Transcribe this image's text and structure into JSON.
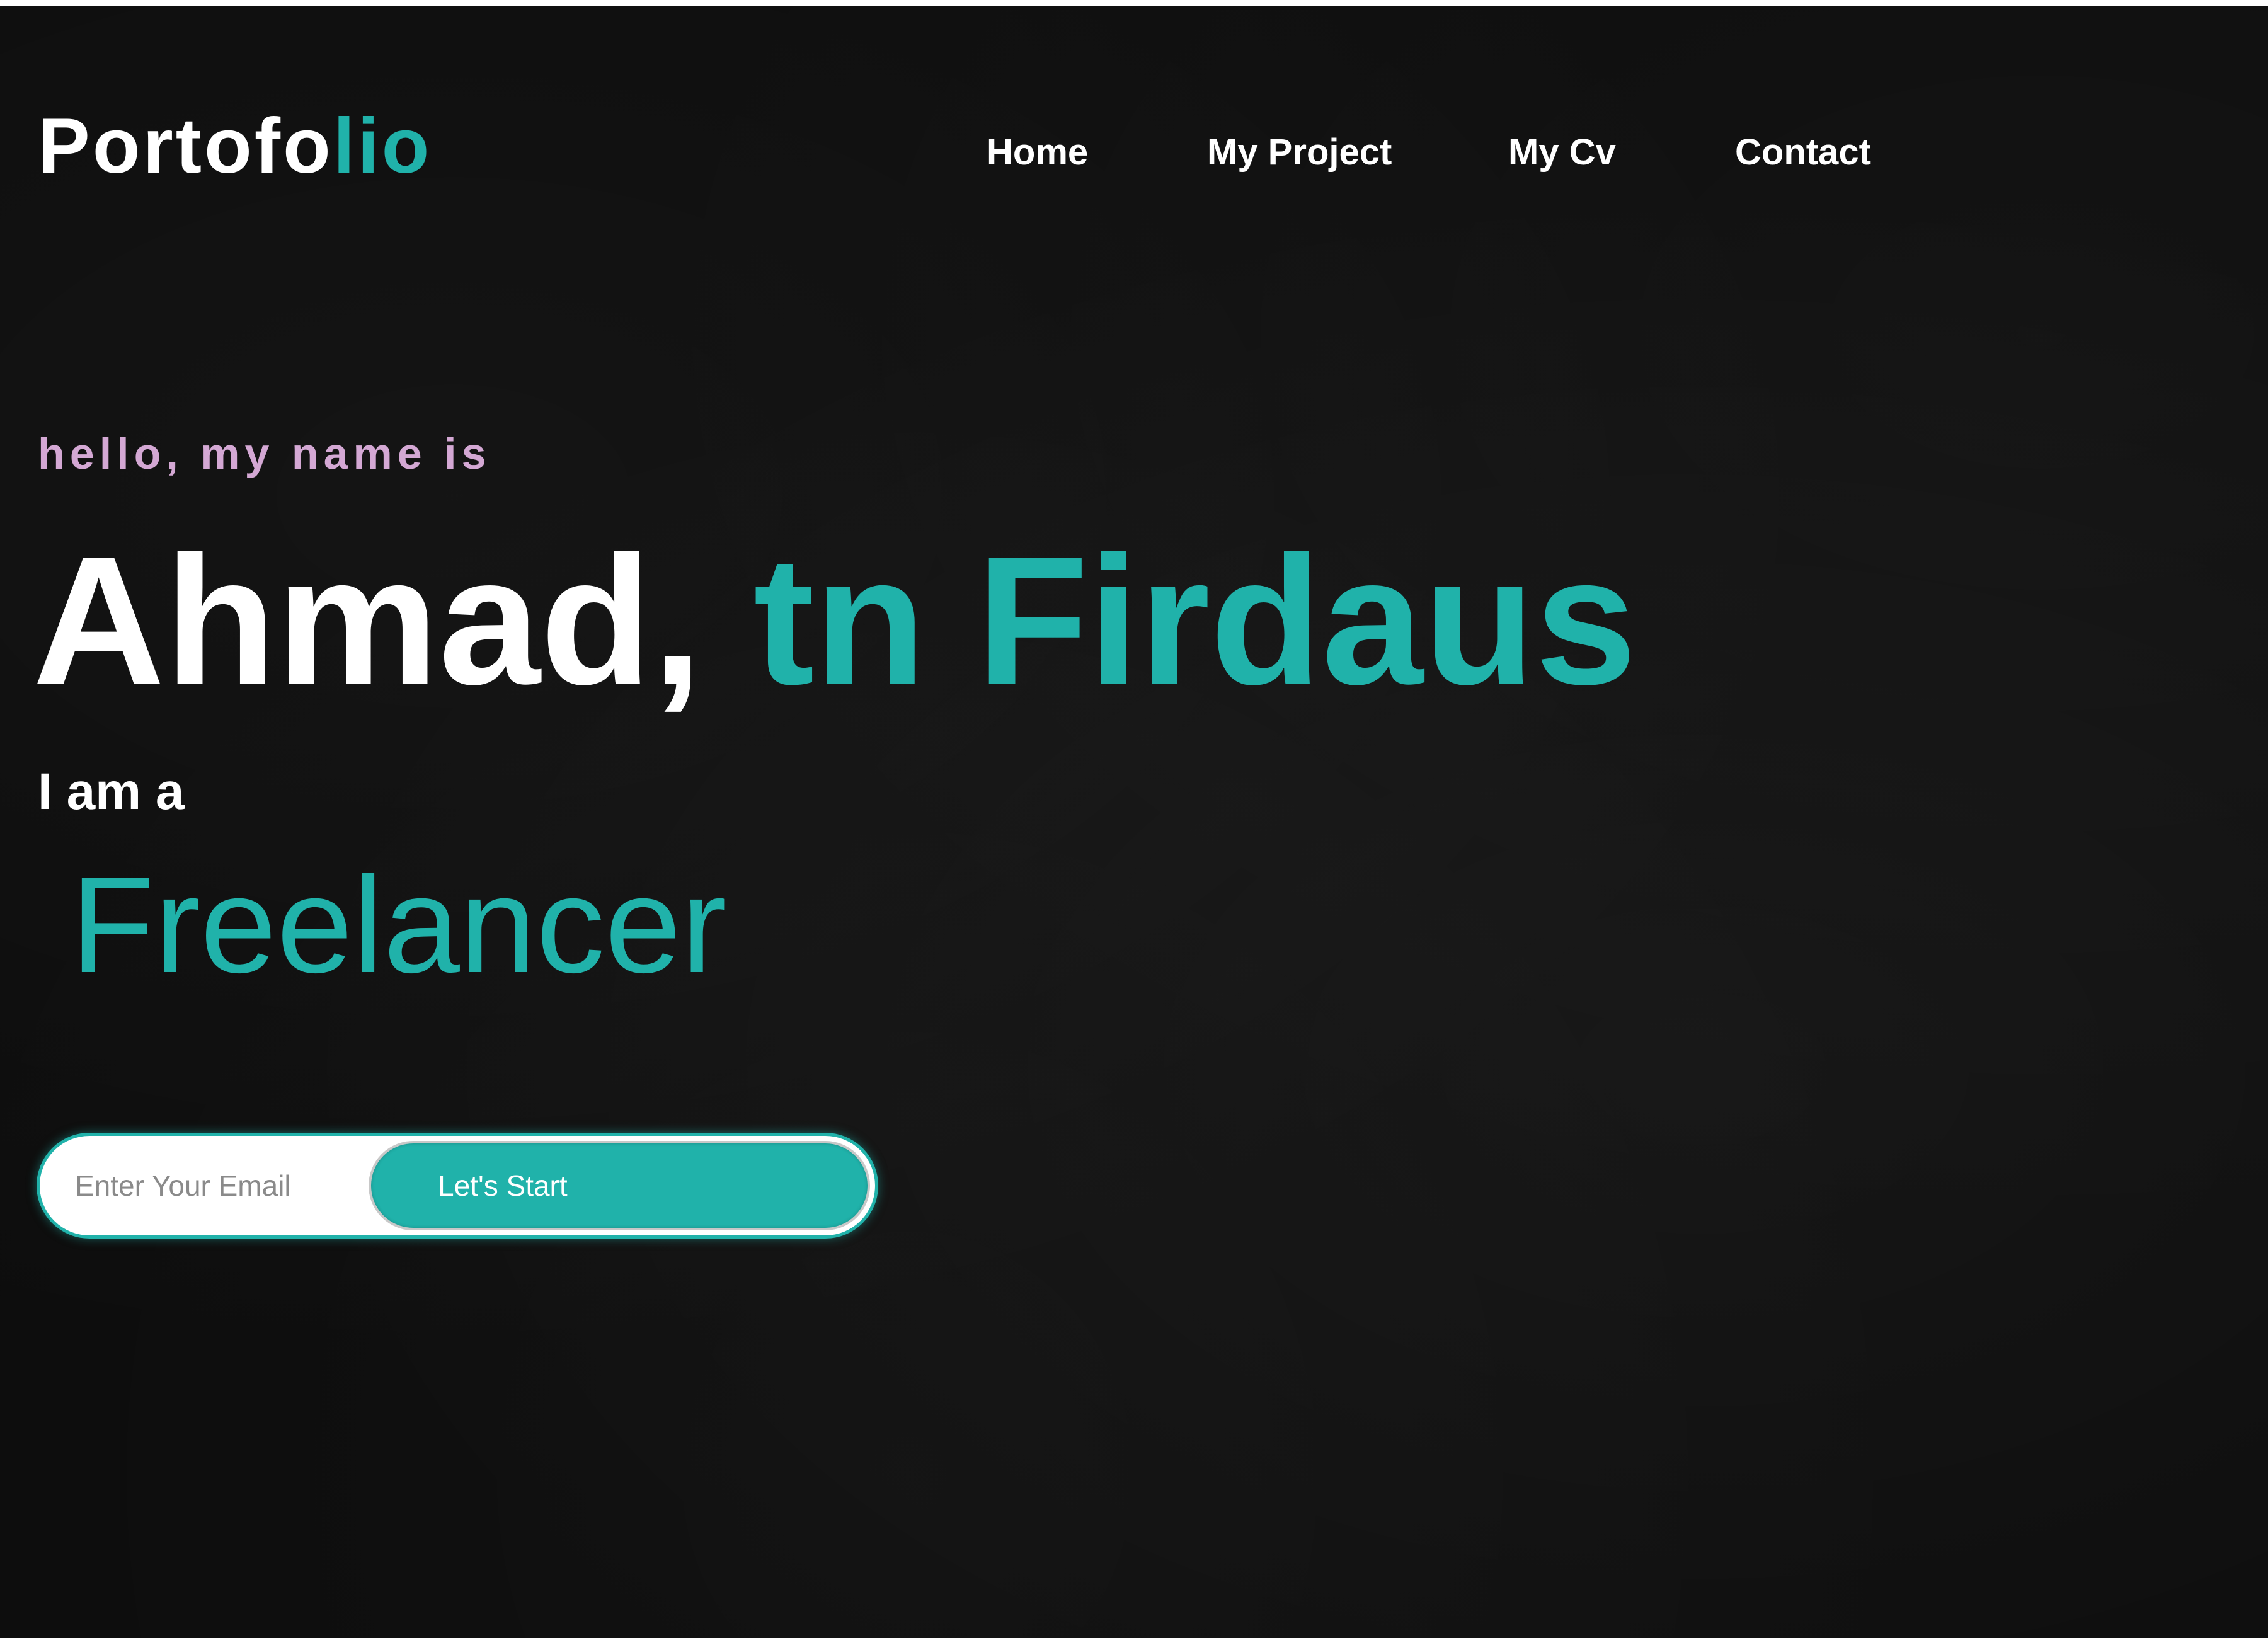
{
  "brand": {
    "logo_main": "Portofo",
    "logo_accent": "lio"
  },
  "nav": {
    "items": [
      {
        "label": "Home"
      },
      {
        "label": "My Project"
      },
      {
        "label": "My Cv"
      },
      {
        "label": "Contact"
      }
    ]
  },
  "hero": {
    "greeting": "hello, my name is",
    "name_first": "Ahmad,",
    "name_last": "tn Firdaus",
    "intro": "I am a",
    "role": "Freelancer"
  },
  "signup": {
    "email_placeholder": "Enter Your Email",
    "email_value": "",
    "button_label": "Let's Start"
  },
  "colors": {
    "accent": "#20b2aa",
    "background": "#0c0c0c",
    "greeting": "#d4a8d4",
    "text": "#ffffff"
  }
}
